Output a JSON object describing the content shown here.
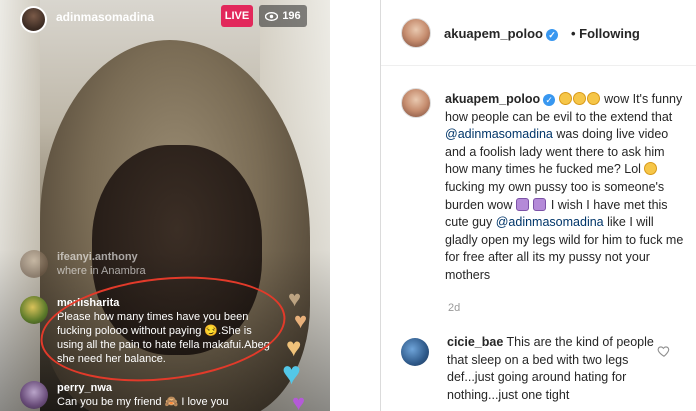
{
  "live": {
    "host_username": "adinmasomadina",
    "live_badge": "LIVE",
    "viewer_count": "196",
    "comments": [
      {
        "username": "ifeanyi.anthony",
        "text": "where in Anambra",
        "faded": true
      },
      {
        "username": "merlisharita",
        "text": "Please how many times have you been fucking polooo without paying 😏.She is using all the pain to hate fella makafui.Abeg she need her balance."
      },
      {
        "username": "perry_nwa",
        "text": "Can you be my friend 🙈 I love you"
      }
    ],
    "colors": {
      "live_red": "#e2285b",
      "annotation_red": "#e23a2a"
    }
  },
  "post": {
    "header": {
      "username": "akuapem_poloo",
      "follow_state": "Following"
    },
    "caption": {
      "username": "akuapem_poloo",
      "part1": " wow It's funny how people can be evil to the extend that ",
      "mention1": "@adinmasomadina",
      "part2": " was doing live video and a foolish lady went there to ask him how many times he fucked me? Lol ",
      "part3": " fucking my own pussy too is someone's burden wow ",
      "part4": " I wish I have met this cute guy ",
      "mention2": "@adinmasomadina",
      "part5": " like I will gladly open my legs wild for him to fuck me for free after all its my pussy not your mothers"
    },
    "time_ago": "2d",
    "comment": {
      "username": "cicie_bae",
      "text": " This are the kind of people that sleep on a bed with two legs def...just going around hating for nothing...just one tight"
    },
    "icons": {
      "verified": "verified-badge-icon",
      "like": "heart-outline-icon"
    },
    "colors": {
      "verified_blue": "#3897f0",
      "mention": "#003569",
      "text": "#262626",
      "muted": "#999999"
    }
  }
}
